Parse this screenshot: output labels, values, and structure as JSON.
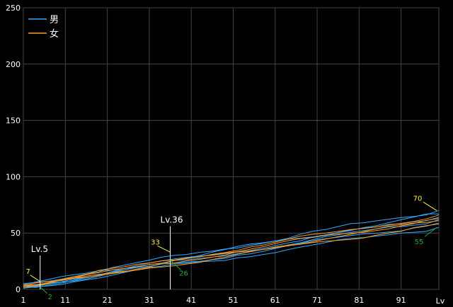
{
  "chart_data": {
    "type": "line",
    "title": "",
    "xlabel": "Lv",
    "ylabel": "",
    "xlim": [
      1,
      100
    ],
    "ylim": [
      0,
      250
    ],
    "x_ticks": [
      1,
      11,
      21,
      31,
      41,
      51,
      61,
      71,
      81,
      91
    ],
    "x_tick_labels": [
      "1",
      "11",
      "21",
      "31",
      "41",
      "51",
      "61",
      "71",
      "81",
      "91"
    ],
    "y_ticks": [
      0,
      50,
      100,
      150,
      200,
      250
    ],
    "y_tick_labels": [
      "0",
      "50",
      "100",
      "150",
      "200",
      "250"
    ],
    "grid": true,
    "legend_position": "top-left",
    "colors": {
      "male": "#33aaff",
      "female": "#ff9922",
      "marker": "#ffffff",
      "label_max": "#ffee44",
      "label_min": "#22aa33",
      "grid": "#444444",
      "text": "#ffffff"
    },
    "legend": [
      {
        "label": "男",
        "color": "#33aaff"
      },
      {
        "label": "女",
        "color": "#ff9922"
      }
    ],
    "markers": [
      {
        "label": "Lv.5",
        "x": 5,
        "max": 7,
        "min": 2,
        "max_label": "7",
        "min_label": "2"
      },
      {
        "label": "Lv.36",
        "x": 36,
        "max": 33,
        "min": 26,
        "max_label": "33",
        "min_label": "26"
      }
    ],
    "end_values": {
      "max": 70,
      "min": 55,
      "max_label": "70",
      "min_label": "55"
    },
    "series": [
      {
        "name": "男",
        "values_at": {
          "1": 5,
          "100": 70
        }
      },
      {
        "name": "男",
        "values_at": {
          "1": 4,
          "100": 67
        }
      },
      {
        "name": "男",
        "values_at": {
          "1": 3,
          "100": 64
        }
      },
      {
        "name": "男",
        "values_at": {
          "1": 2,
          "100": 62
        }
      },
      {
        "name": "男",
        "values_at": {
          "1": 2,
          "100": 59
        }
      },
      {
        "name": "男",
        "values_at": {
          "1": 1,
          "100": 55
        }
      },
      {
        "name": "女",
        "values_at": {
          "1": 4,
          "100": 66
        }
      },
      {
        "name": "女",
        "values_at": {
          "1": 3,
          "100": 63
        }
      },
      {
        "name": "女",
        "values_at": {
          "1": 3,
          "100": 61
        }
      },
      {
        "name": "女",
        "values_at": {
          "1": 2,
          "100": 58
        }
      }
    ]
  }
}
